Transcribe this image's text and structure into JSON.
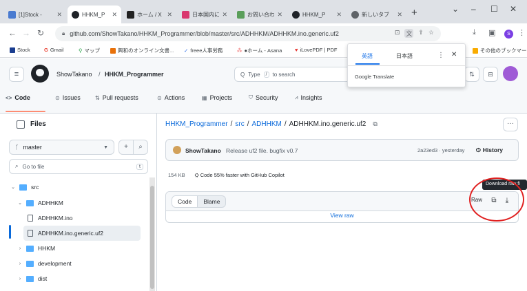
{
  "tabs": [
    {
      "title": "[1]Stock -",
      "fav": "#4a7bd0"
    },
    {
      "title": "HHKM_P",
      "fav": "#1f2328"
    },
    {
      "title": "ホーム / X",
      "fav": "#222222"
    },
    {
      "title": "日本国内に",
      "fav": "#d9376e"
    },
    {
      "title": "お問い合わ",
      "fav": "#5a9e5a"
    },
    {
      "title": "HHKM_P",
      "fav": "#1f2328"
    },
    {
      "title": "新しいタブ",
      "fav": "#5f6368"
    }
  ],
  "browser": {
    "url": "github.com/ShowTakano/HHKM_Programmer/blob/master/src/ADHHKM/ADHHKM.ino.generic.uf2",
    "profile_initial": "S"
  },
  "bookmarks": [
    {
      "label": "Stock",
      "color": "#1a3d8f"
    },
    {
      "label": "Gmail",
      "color": "#ea4335"
    },
    {
      "label": "マップ",
      "color": "#34a853"
    },
    {
      "label": "興和のオンライン文書...",
      "color": "#e8710a"
    },
    {
      "label": "freee人事労務",
      "color": "#2a6be8"
    },
    {
      "label": "●ホーム - Asana",
      "color": "#f06a6a"
    },
    {
      "label": "iLovePDF | PDF",
      "color": "#e5322d"
    },
    {
      "label": "その他のブックマーク",
      "color": "#f9ab00"
    }
  ],
  "translate": {
    "lang_from": "英語",
    "lang_to": "日本語",
    "label": "Google Translate"
  },
  "github": {
    "owner": "ShowTakano",
    "slash": "/",
    "repo": "HHKM_Programmer",
    "search_prefix": "Q",
    "search_before": "Type",
    "search_kbd": "/",
    "search_after": "to search",
    "nav": [
      {
        "label": "Code",
        "icon": "<>"
      },
      {
        "label": "Issues",
        "icon": "⊙"
      },
      {
        "label": "Pull requests",
        "icon": "⇅"
      },
      {
        "label": "Actions",
        "icon": "⊙"
      },
      {
        "label": "Projects",
        "icon": "▦"
      },
      {
        "label": "Security",
        "icon": "⛉"
      },
      {
        "label": "Insights",
        "icon": "⩘"
      }
    ]
  },
  "sidebar": {
    "title": "Files",
    "branch": "master",
    "goto_placeholder": "Go to file",
    "goto_kbd": "t",
    "tree": [
      {
        "label": "src",
        "type": "folder",
        "chev": "⌄"
      },
      {
        "label": "ADHHKM",
        "type": "folder",
        "chev": "⌄"
      },
      {
        "label": "ADHHKM.ino",
        "type": "file",
        "chev": ""
      },
      {
        "label": "ADHHKM.ino.generic.uf2",
        "type": "file",
        "chev": ""
      },
      {
        "label": "HHKM",
        "type": "folder",
        "chev": "›"
      },
      {
        "label": "development",
        "type": "folder",
        "chev": "›"
      },
      {
        "label": "dist",
        "type": "folder",
        "chev": "›"
      }
    ]
  },
  "file": {
    "path_repo": "HHKM_Programmer",
    "path_src": "src",
    "path_dir": "ADHHKM",
    "filename": "ADHHKM.ino.generic.uf2",
    "sep": "/",
    "commit_user": "ShowTakano",
    "commit_msg": "Release uf2 file. bugfix v0.7",
    "commit_hash": "2a23ed3 · yesterday",
    "history": "History",
    "size": "154 KB",
    "copilot": "Code 55% faster with GitHub Copilot",
    "tab_code": "Code",
    "tab_blame": "Blame",
    "raw": "Raw",
    "view_raw": "View raw",
    "tooltip": "Download raw fi"
  }
}
